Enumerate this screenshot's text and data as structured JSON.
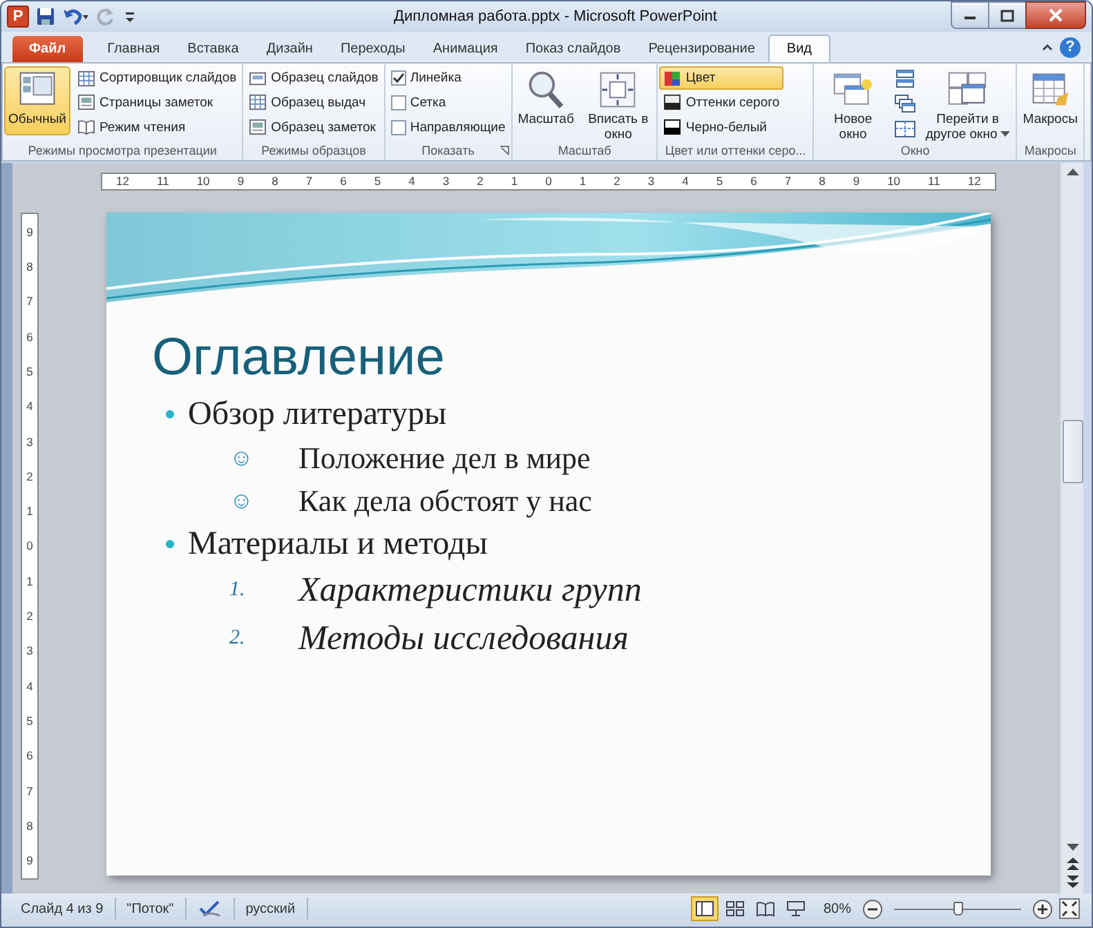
{
  "window": {
    "title": "Дипломная работа.pptx - Microsoft PowerPoint",
    "app_icon_letter": "P",
    "help_label": "?"
  },
  "quick_access": [
    {
      "kind": "save",
      "disabled": false
    },
    {
      "kind": "undo",
      "disabled": false
    },
    {
      "kind": "redo",
      "disabled": true
    },
    {
      "kind": "customize",
      "disabled": false
    }
  ],
  "tabs": [
    {
      "label": "Файл",
      "kind": "file",
      "selected": false
    },
    {
      "label": "Главная",
      "kind": "tab",
      "selected": false
    },
    {
      "label": "Вставка",
      "kind": "tab",
      "selected": false
    },
    {
      "label": "Дизайн",
      "kind": "tab",
      "selected": false
    },
    {
      "label": "Переходы",
      "kind": "tab",
      "selected": false
    },
    {
      "label": "Анимация",
      "kind": "tab",
      "selected": false
    },
    {
      "label": "Показ слайдов",
      "kind": "tab",
      "selected": false
    },
    {
      "label": "Рецензирование",
      "kind": "tab",
      "selected": false
    },
    {
      "label": "Вид",
      "kind": "tab",
      "selected": true
    }
  ],
  "ribbon": {
    "groups": [
      {
        "label": "Режимы просмотра презентации",
        "columns": [
          {
            "kind": "large",
            "label": "Обычный",
            "selected": true
          },
          {
            "kind": "stack",
            "items": [
              {
                "kind": "button",
                "label": "Сортировщик слайдов",
                "selected": false
              },
              {
                "kind": "button",
                "label": "Страницы заметок",
                "selected": false
              },
              {
                "kind": "button",
                "label": "Режим чтения",
                "selected": false
              }
            ]
          }
        ]
      },
      {
        "label": "Режимы образцов",
        "columns": [
          {
            "kind": "stack",
            "items": [
              {
                "kind": "button",
                "label": "Образец слайдов",
                "selected": false
              },
              {
                "kind": "button",
                "label": "Образец выдач",
                "selected": false
              },
              {
                "kind": "button",
                "label": "Образец заметок",
                "selected": false
              }
            ]
          }
        ]
      },
      {
        "label": "Показать",
        "launcher": true,
        "columns": [
          {
            "kind": "stack",
            "items": [
              {
                "kind": "check",
                "label": "Линейка",
                "checked": true
              },
              {
                "kind": "check",
                "label": "Сетка",
                "checked": false
              },
              {
                "kind": "check",
                "label": "Направляющие",
                "checked": false
              }
            ]
          }
        ]
      },
      {
        "label": "Масштаб",
        "columns": [
          {
            "kind": "large",
            "label": "Масштаб",
            "selected": false
          },
          {
            "kind": "large",
            "label": "Вписать в окно",
            "selected": false
          }
        ]
      },
      {
        "label": "Цвет или оттенки серо...",
        "columns": [
          {
            "kind": "stack",
            "items": [
              {
                "kind": "button",
                "label": "Цвет",
                "selected": true
              },
              {
                "kind": "button",
                "label": "Оттенки серого",
                "selected": false
              },
              {
                "kind": "button",
                "label": "Черно-белый",
                "selected": false
              }
            ]
          }
        ]
      },
      {
        "label": "Окно",
        "columns": [
          {
            "kind": "large",
            "label": "Новое окно",
            "selected": false
          },
          {
            "kind": "icons",
            "items": [
              {
                "kind": "arrange"
              },
              {
                "kind": "cascade"
              },
              {
                "kind": "split"
              }
            ]
          },
          {
            "kind": "large",
            "label": "Перейти в другое окно",
            "selected": false,
            "dropdown": true
          }
        ]
      },
      {
        "label": "Макросы",
        "columns": [
          {
            "kind": "large",
            "label": "Макросы",
            "selected": false
          }
        ]
      }
    ]
  },
  "ruler_horizontal": [
    "12",
    "11",
    "10",
    "9",
    "8",
    "7",
    "6",
    "5",
    "4",
    "3",
    "2",
    "1",
    "0",
    "1",
    "2",
    "3",
    "4",
    "5",
    "6",
    "7",
    "8",
    "9",
    "10",
    "11",
    "12"
  ],
  "ruler_vertical": [
    "9",
    "8",
    "7",
    "6",
    "5",
    "4",
    "3",
    "2",
    "1",
    "0",
    "1",
    "2",
    "3",
    "4",
    "5",
    "6",
    "7",
    "8",
    "9"
  ],
  "slide": {
    "title": "Оглавление",
    "items": [
      {
        "kind": "bullet",
        "text": "Обзор литературы",
        "children": [
          {
            "kind": "symbol",
            "marker": "☺",
            "text": "Положение дел в мире"
          },
          {
            "kind": "symbol",
            "marker": "☺",
            "text": "Как дела обстоят у нас"
          }
        ]
      },
      {
        "kind": "bullet",
        "text": "Материалы и методы",
        "children": [
          {
            "kind": "numbered",
            "marker": "1.",
            "text": "Характеристики групп"
          },
          {
            "kind": "numbered",
            "marker": "2.",
            "text": "Методы исследования"
          }
        ]
      }
    ]
  },
  "status_bar": {
    "slide": "Слайд 4 из 9",
    "theme": "\"Поток\"",
    "language": "русский",
    "views": [
      {
        "kind": "normal",
        "selected": true
      },
      {
        "kind": "sorter",
        "selected": false
      },
      {
        "kind": "reading",
        "selected": false
      },
      {
        "kind": "show",
        "selected": false
      }
    ],
    "zoom": "80%",
    "zoom_slider": {
      "level": 0.5
    }
  }
}
